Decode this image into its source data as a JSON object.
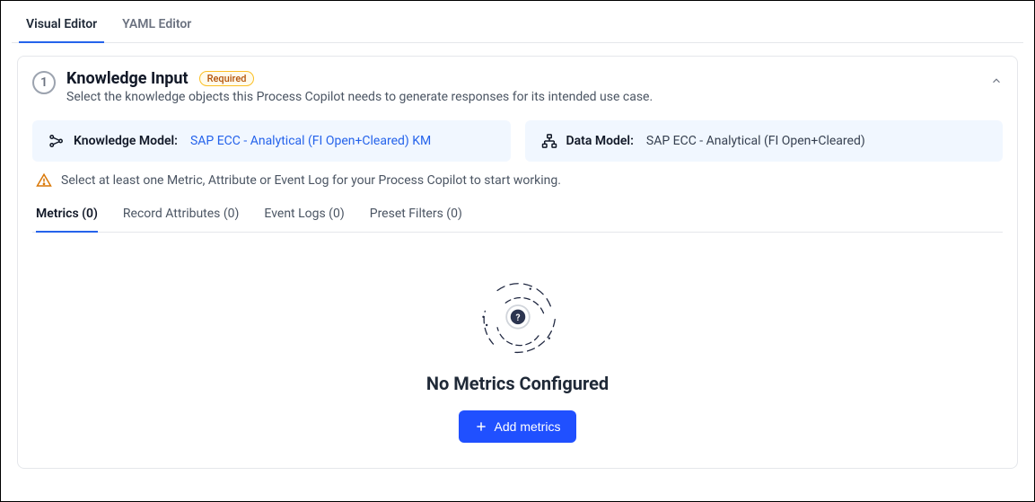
{
  "editorTabs": {
    "visual": "Visual Editor",
    "yaml": "YAML Editor"
  },
  "step": {
    "number": "1",
    "title": "Knowledge Input",
    "badge": "Required",
    "description": "Select the knowledge objects this Process Copilot needs to generate responses for its intended use case."
  },
  "knowledgeModel": {
    "label": "Knowledge Model:",
    "value": "SAP ECC - Analytical (FI Open+Cleared) KM"
  },
  "dataModel": {
    "label": "Data Model:",
    "value": "SAP ECC - Analytical (FI Open+Cleared)"
  },
  "warning": "Select at least one Metric, Attribute or Event Log for your Process Copilot to start working.",
  "innerTabs": {
    "metrics": "Metrics (0)",
    "recordAttributes": "Record Attributes (0)",
    "eventLogs": "Event Logs (0)",
    "presetFilters": "Preset Filters (0)"
  },
  "emptyState": {
    "title": "No Metrics Configured",
    "button": "Add metrics"
  }
}
